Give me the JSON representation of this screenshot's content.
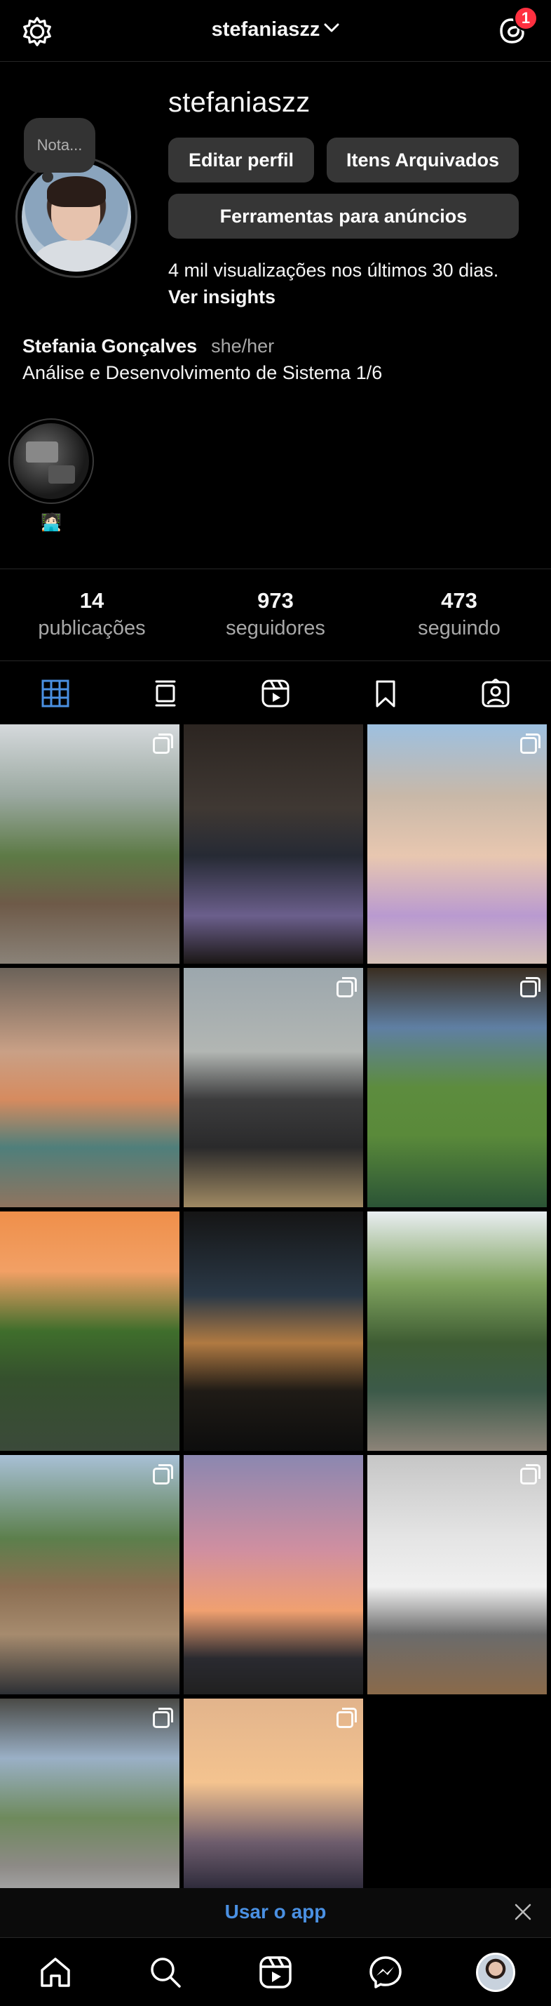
{
  "header": {
    "username": "stefaniaszz",
    "notification_count": "1"
  },
  "profile": {
    "note_placeholder": "Nota...",
    "username": "stefaniaszz",
    "edit_profile_label": "Editar perfil",
    "archived_label": "Itens Arquivados",
    "ad_tools_label": "Ferramentas para anúncios",
    "views_text": "4 mil visualizações nos últimos 30 dias.",
    "insights_label": "Ver insights",
    "full_name": "Stefania Gonçalves",
    "pronouns": "she/her",
    "bio": "Análise e Desenvolvimento de Sistema 1/6"
  },
  "highlights": [
    {
      "label": "🧑🏻‍💻"
    }
  ],
  "stats": [
    {
      "value": "14",
      "label": "publicações"
    },
    {
      "value": "973",
      "label": "seguidores"
    },
    {
      "value": "473",
      "label": "seguindo"
    }
  ],
  "tabs": [
    {
      "name": "grid-icon",
      "active": true
    },
    {
      "name": "feed-icon",
      "active": false
    },
    {
      "name": "reels-icon",
      "active": false
    },
    {
      "name": "saved-icon",
      "active": false
    },
    {
      "name": "tagged-icon",
      "active": false
    }
  ],
  "posts": [
    {
      "multi": true
    },
    {
      "multi": false
    },
    {
      "multi": true
    },
    {
      "multi": false
    },
    {
      "multi": true
    },
    {
      "multi": true
    },
    {
      "multi": false
    },
    {
      "multi": false
    },
    {
      "multi": false
    },
    {
      "multi": true
    },
    {
      "multi": false
    },
    {
      "multi": true
    },
    {
      "multi": true
    },
    {
      "multi": true
    }
  ],
  "app_banner": {
    "label": "Usar o app"
  },
  "colors": {
    "background": "#000000",
    "button": "#363636",
    "link_blue": "#4a90e2",
    "badge_red": "#ff3040",
    "muted_text": "#a8a8a8"
  }
}
